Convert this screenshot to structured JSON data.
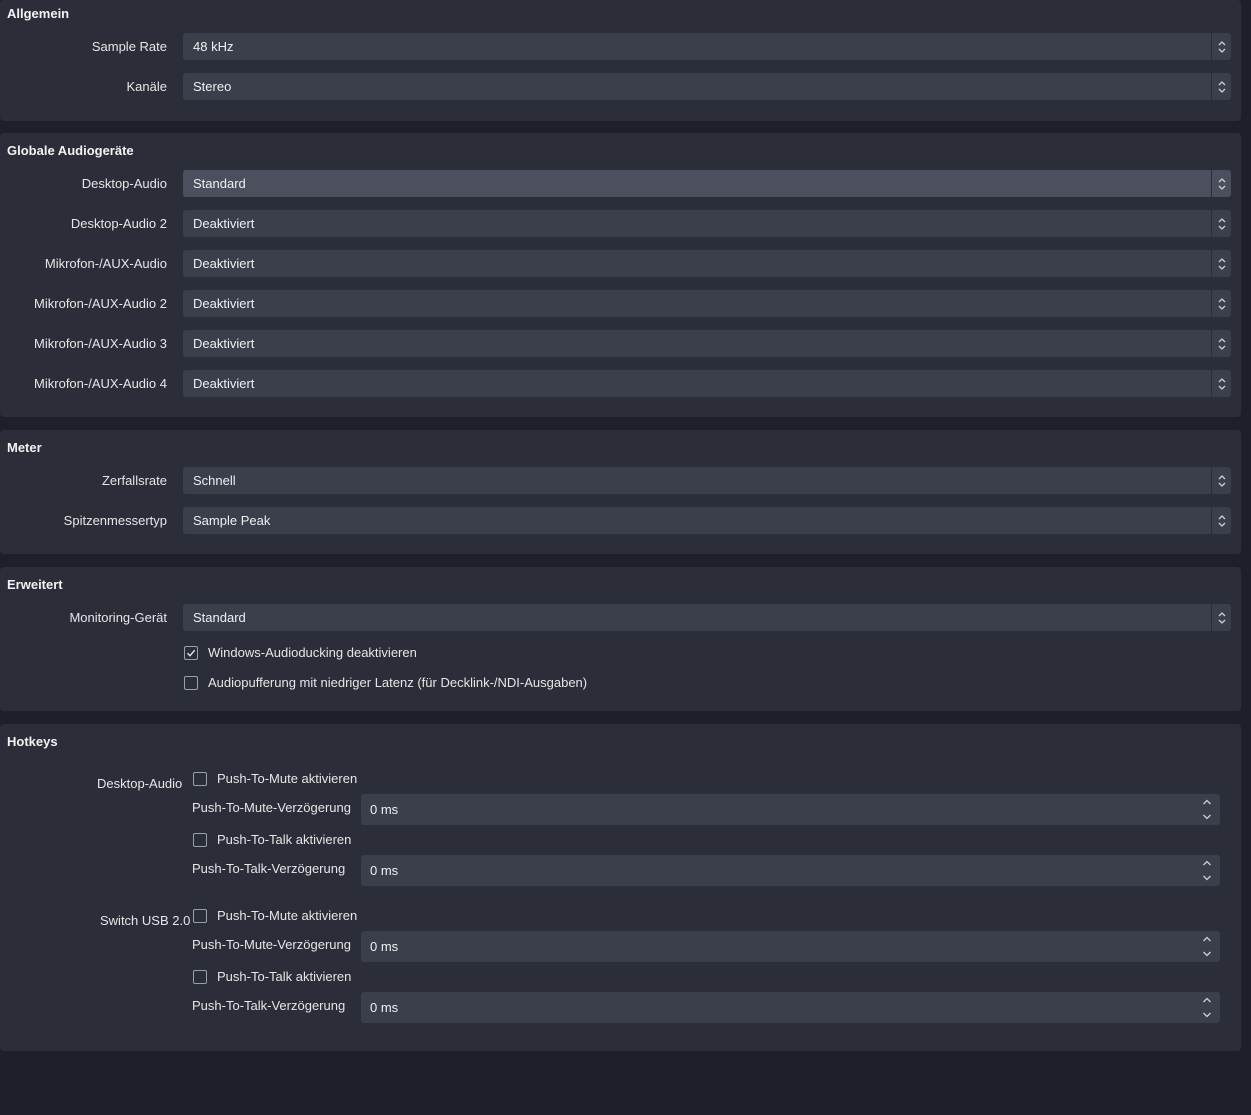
{
  "allgemein": {
    "title": "Allgemein",
    "sample_rate_label": "Sample Rate",
    "sample_rate_value": "48 kHz",
    "kanaele_label": "Kanäle",
    "kanaele_value": "Stereo"
  },
  "devices": {
    "title": "Globale Audiogeräte",
    "rows": [
      {
        "label": "Desktop-Audio",
        "value": "Standard"
      },
      {
        "label": "Desktop-Audio 2",
        "value": "Deaktiviert"
      },
      {
        "label": "Mikrofon-/AUX-Audio",
        "value": "Deaktiviert"
      },
      {
        "label": "Mikrofon-/AUX-Audio 2",
        "value": "Deaktiviert"
      },
      {
        "label": "Mikrofon-/AUX-Audio 3",
        "value": "Deaktiviert"
      },
      {
        "label": "Mikrofon-/AUX-Audio 4",
        "value": "Deaktiviert"
      }
    ]
  },
  "meter": {
    "title": "Meter",
    "decay_label": "Zerfallsrate",
    "decay_value": "Schnell",
    "peak_label": "Spitzenmessertyp",
    "peak_value": "Sample Peak"
  },
  "erweitert": {
    "title": "Erweitert",
    "monitoring_label": "Monitoring-Gerät",
    "monitoring_value": "Standard",
    "ducking_label": "Windows-Audioducking deaktivieren",
    "ducking_checked": true,
    "lowlatency_label": "Audiopufferung mit niedriger Latenz (für Decklink-/NDI-Ausgaben)",
    "lowlatency_checked": false
  },
  "hotkeys": {
    "title": "Hotkeys",
    "sources": [
      {
        "name": "Desktop-Audio",
        "ptm_label": "Push-To-Mute aktivieren",
        "ptm_delay_label": "Push-To-Mute-Verzögerung",
        "ptm_delay_value": "0 ms",
        "ptt_label": "Push-To-Talk aktivieren",
        "ptt_delay_label": "Push-To-Talk-Verzögerung",
        "ptt_delay_value": "0 ms"
      },
      {
        "name": "Switch USB 2.0",
        "ptm_label": "Push-To-Mute aktivieren",
        "ptm_delay_label": "Push-To-Mute-Verzögerung",
        "ptm_delay_value": "0 ms",
        "ptt_label": "Push-To-Talk aktivieren",
        "ptt_delay_label": "Push-To-Talk-Verzögerung",
        "ptt_delay_value": "0 ms"
      }
    ]
  },
  "icons": {
    "combo_arrow": "updown-chevron-icon",
    "spin_arrow": "spin-updown-icon",
    "check": "checkmark-icon"
  },
  "colors": {
    "background": "#1e1f28",
    "group_bg": "#2b2e38",
    "field_bg": "#3b3f4c",
    "field_hover_bg": "#4c505e"
  }
}
